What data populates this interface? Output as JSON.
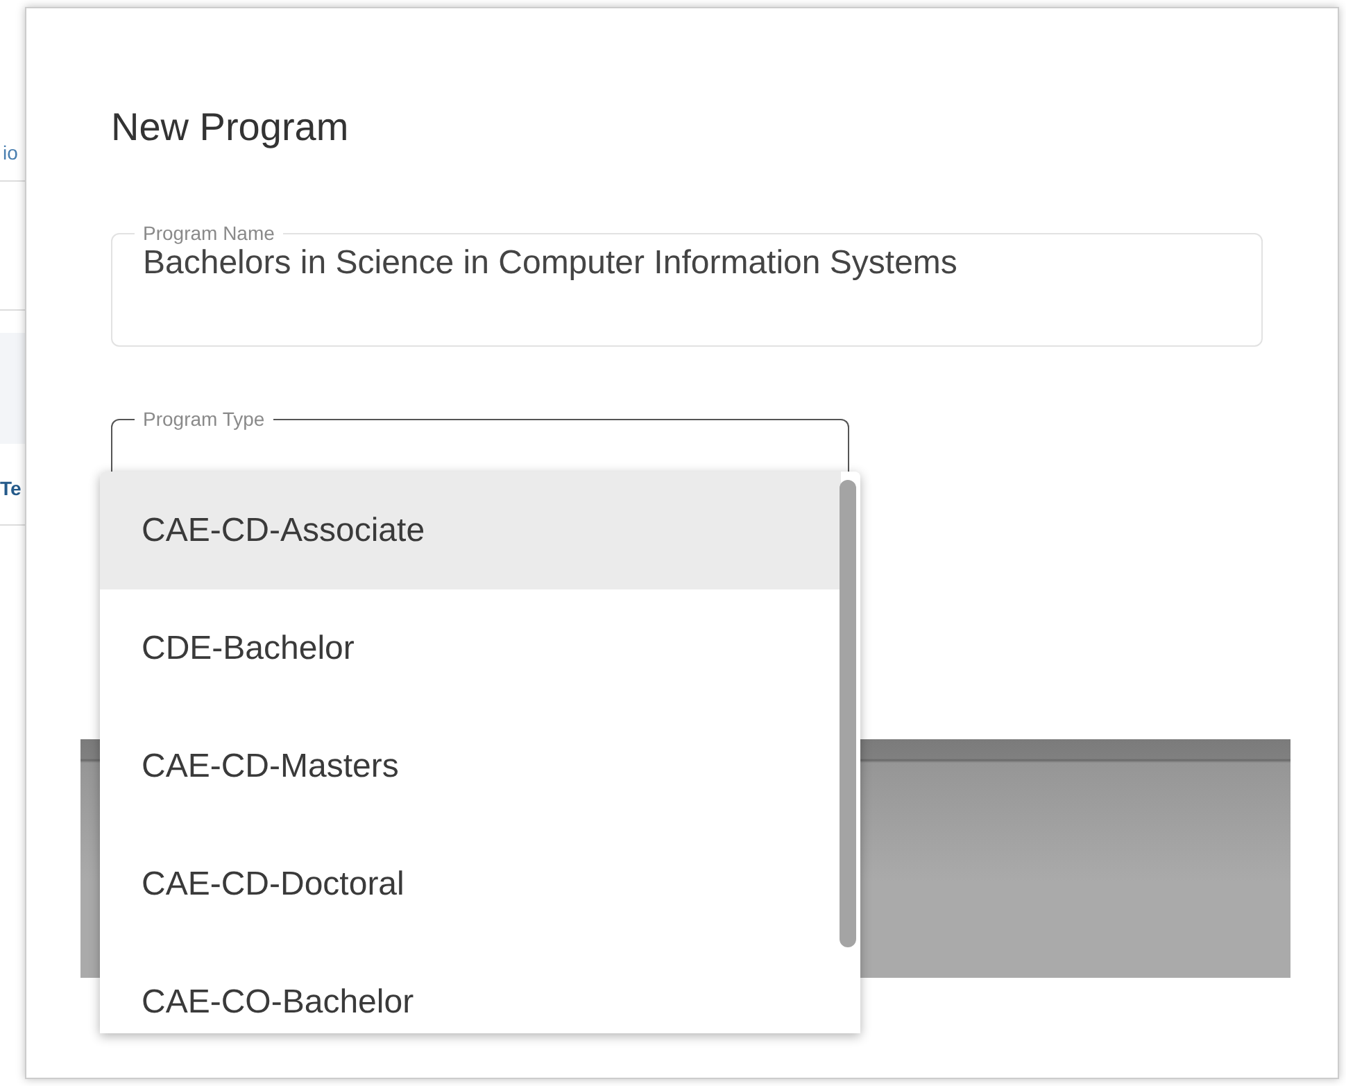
{
  "background": {
    "texts": [
      "io",
      "Te"
    ]
  },
  "dialog": {
    "title": "New Program",
    "name_field": {
      "label": "Program Name",
      "value": "Bachelors in Science in Computer Information Systems"
    },
    "type_field": {
      "label": "Program Type"
    },
    "options": [
      {
        "label": "CAE-CD-Associate",
        "selected": true
      },
      {
        "label": "CDE-Bachelor",
        "selected": false
      },
      {
        "label": "CAE-CD-Masters",
        "selected": false
      },
      {
        "label": "CAE-CD-Doctoral",
        "selected": false
      },
      {
        "label": "CAE-CO-Bachelor",
        "selected": false
      }
    ]
  }
}
